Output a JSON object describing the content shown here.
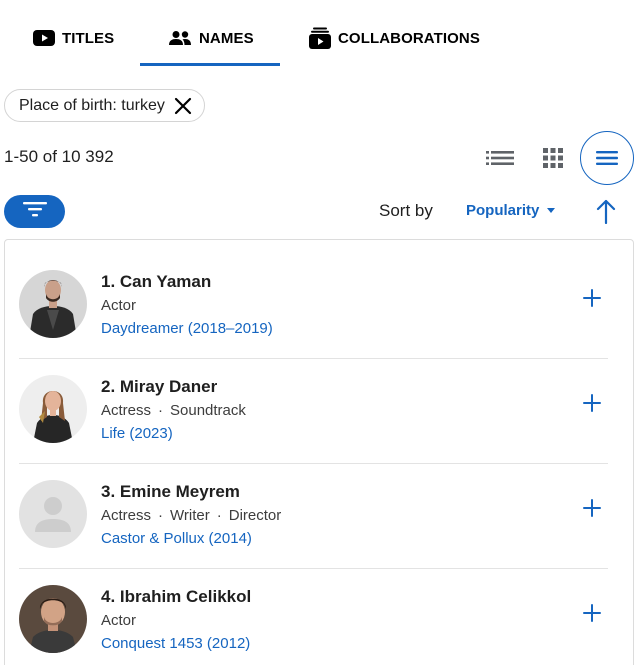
{
  "tabs": [
    {
      "label": "TITLES",
      "icon": "youtube-play-icon",
      "active": false
    },
    {
      "label": "NAMES",
      "icon": "people-icon",
      "active": true
    },
    {
      "label": "COLLABORATIONS",
      "icon": "collection-icon",
      "active": false
    }
  ],
  "filter_chip": {
    "label": "Place of birth: turkey",
    "close_icon": "close-icon"
  },
  "result_count": "1-50 of 10 392",
  "view_options": [
    {
      "name": "list-view-icon",
      "selected": false
    },
    {
      "name": "grid-view-icon",
      "selected": false
    },
    {
      "name": "detailed-view-icon",
      "selected": true
    }
  ],
  "sort": {
    "label": "Sort by",
    "value": "Popularity",
    "direction_icon": "arrow-up-icon"
  },
  "colors": {
    "accent": "#1565c0",
    "text": "#1f1f1f",
    "muted": "#3d3d3d",
    "border": "#dcdcdc"
  },
  "results": [
    {
      "name": "1. Can Yaman",
      "roles": [
        "Actor"
      ],
      "known_for": "Daydreamer (2018–2019)",
      "avatar": "photo"
    },
    {
      "name": "2. Miray Daner",
      "roles": [
        "Actress",
        "Soundtrack"
      ],
      "known_for": "Life (2023)",
      "avatar": "photo"
    },
    {
      "name": "3. Emine Meyrem",
      "roles": [
        "Actress",
        "Writer",
        "Director"
      ],
      "known_for": "Castor & Pollux (2014)",
      "avatar": "placeholder"
    },
    {
      "name": "4. Ibrahim Celikkol",
      "roles": [
        "Actor"
      ],
      "known_for": "Conquest 1453 (2012)",
      "avatar": "photo"
    }
  ]
}
